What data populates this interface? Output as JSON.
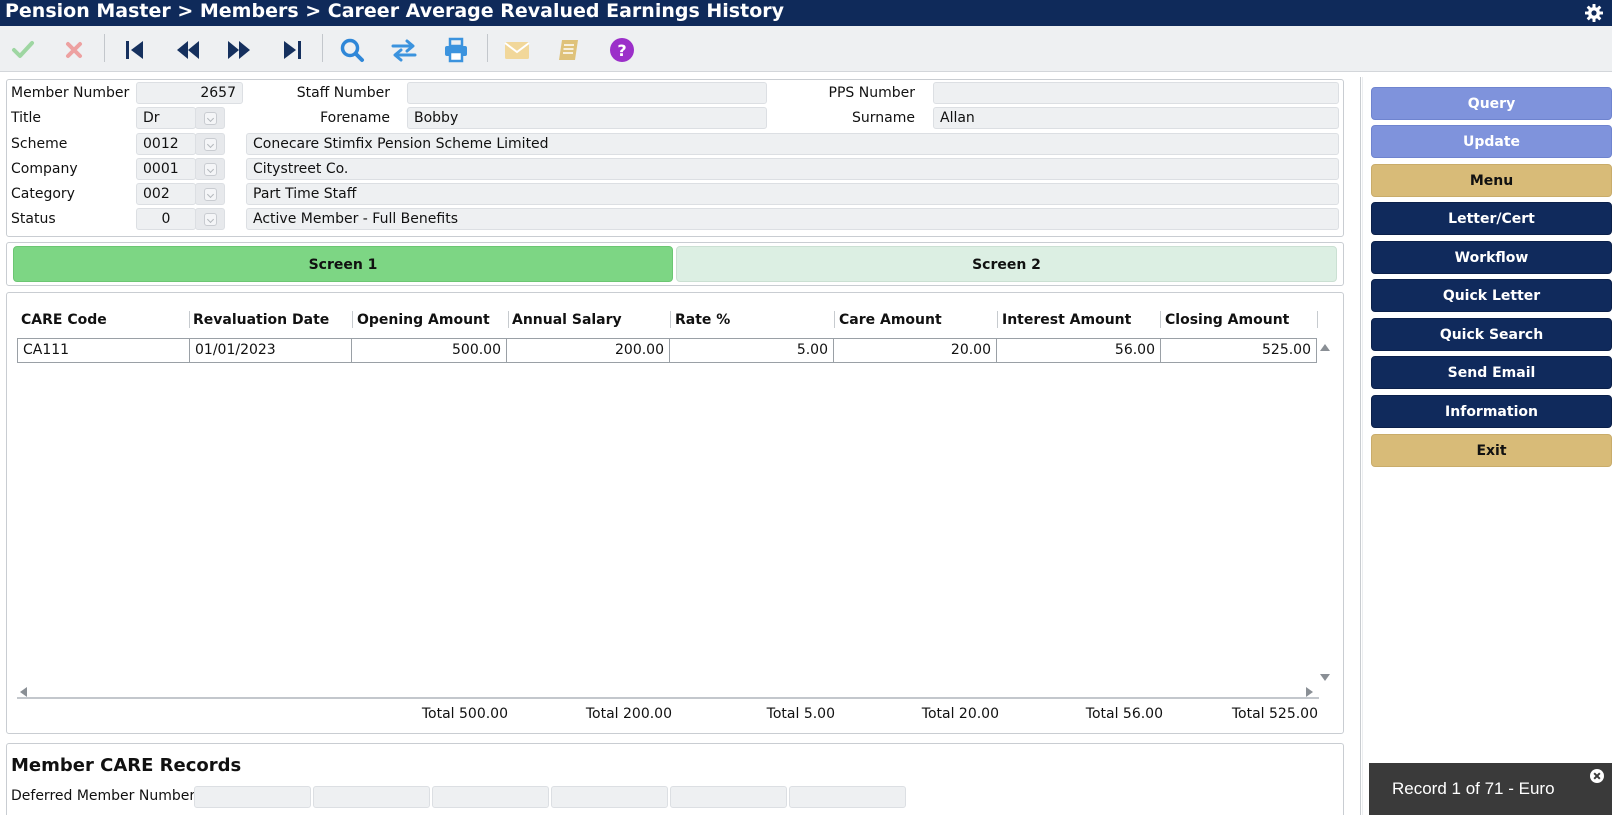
{
  "app": {
    "title": "Pension Master > Members > Career Average Revalued Earnings History"
  },
  "toolbar": {
    "icons": [
      "check-icon",
      "cancel-icon",
      "first-record-icon",
      "previous-record-icon",
      "next-record-icon",
      "last-record-icon",
      "search-icon",
      "swap-icon",
      "print-icon",
      "email-icon",
      "notes-icon",
      "help-icon"
    ]
  },
  "member": {
    "labels": {
      "member_number": "Member Number",
      "staff_number": "Staff Number",
      "pps_number": "PPS Number",
      "title": "Title",
      "forename": "Forename",
      "surname": "Surname",
      "scheme": "Scheme",
      "company": "Company",
      "category": "Category",
      "status": "Status"
    },
    "member_number": "2657",
    "staff_number": "",
    "pps_number": "",
    "title": "Dr",
    "forename": "Bobby",
    "surname": "Allan",
    "scheme_code": "0012",
    "scheme_name": "Conecare Stimfix Pension Scheme Limited",
    "company_code": "0001",
    "company_name": "Citystreet Co.",
    "category_code": "002",
    "category_name": "Part Time Staff",
    "status_code": "0",
    "status_name": "Active Member - Full Benefits"
  },
  "tabs": [
    {
      "label": "Screen 1",
      "active": true
    },
    {
      "label": "Screen 2",
      "active": false
    }
  ],
  "grid": {
    "columns": [
      "CARE Code",
      "Revaluation Date",
      "Opening Amount",
      "Annual Salary",
      "Rate %",
      "Care Amount",
      "Interest Amount",
      "Closing Amount"
    ],
    "rows": [
      [
        "CA111",
        "01/01/2023",
        "500.00",
        "200.00",
        "5.00",
        "20.00",
        "56.00",
        "525.00"
      ]
    ],
    "totals": [
      "Total 500.00",
      "Total 200.00",
      "Total 5.00",
      "Total 20.00",
      "Total 56.00",
      "Total 525.00"
    ]
  },
  "care_records": {
    "title": "Member CARE Records",
    "deferred_label": "Deferred Member Numbers",
    "deferred_values": [
      "",
      "",
      "",
      "",
      "",
      ""
    ]
  },
  "sidebar": {
    "buttons": [
      {
        "label": "Query",
        "style": "blue"
      },
      {
        "label": "Update",
        "style": "blue"
      },
      {
        "label": "Menu",
        "style": "gold"
      },
      {
        "label": "Letter/Cert",
        "style": "navy"
      },
      {
        "label": "Workflow",
        "style": "navy"
      },
      {
        "label": "Quick Letter",
        "style": "navy"
      },
      {
        "label": "Quick Search",
        "style": "navy"
      },
      {
        "label": "Send Email",
        "style": "navy"
      },
      {
        "label": "Information",
        "style": "navy"
      },
      {
        "label": "Exit",
        "style": "gold"
      }
    ]
  },
  "notification": {
    "text": "Record 1 of 71 - Euro"
  },
  "colors": {
    "titlebar": "#0f2a5a",
    "tab_active": "#7dd684",
    "tab_inactive": "#dcefe3",
    "button_blue": "#7f93dc",
    "button_gold": "#d8bb78",
    "button_navy": "#102a5c"
  }
}
